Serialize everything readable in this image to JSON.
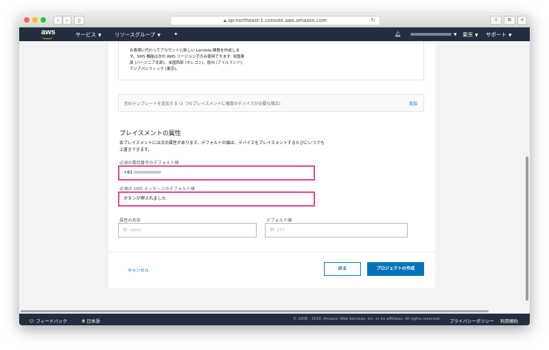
{
  "browser": {
    "url": "ap-northeast-1.console.aws.amazon.com",
    "back_icon": "chevron-left-icon",
    "forward_icon": "chevron-right-icon"
  },
  "nav": {
    "logo": "aws",
    "services": "サービス",
    "resource_groups": "リソースグループ",
    "region": "東京",
    "support": "サポート",
    "bell_icon": "bell-icon",
    "pin_icon": "pin-icon"
  },
  "info": {
    "text": "お客様に代わってアカウントに新しい Lambda 関数を作成します。SMS 機能は次の AWS リージョンでのみ使用できます: 米国東部 (バージニア北部)、米国西部 (オレゴン)、欧州 (アイルランド)、アジアパシフィック (東京)。"
  },
  "add_template": {
    "text": "別のテンプレートを追加する (1 つのプレイスメントに複数のデバイスが必要な場合)",
    "link": "追加"
  },
  "placement": {
    "heading": "プレイスメントの属性",
    "description": "各プレイスメントには次の属性があります。デフォルトの値は、デバイスをプレイスメントするたびにいつでも上書きできます。",
    "phone_label": "必須の電話番号のデフォルト値",
    "phone_value": "+81",
    "sms_label": "必須の SMS メッセージのデフォルト値",
    "sms_value": "ボタンが押されました",
    "attr_name_label": "属性の名前",
    "attr_name_placeholder": "例: room",
    "default_label": "デフォルト値",
    "default_placeholder": "例: 237"
  },
  "actions": {
    "cancel": "キャンセル",
    "back": "戻る",
    "create": "プロジェクトの作成"
  },
  "footer": {
    "feedback": "フィードバック",
    "language": "日本語",
    "copyright": "© 2008 - 2018, Amazon Web Services, Inc. or its affiliates. All rights reserved.",
    "privacy": "プライバシーポリシー",
    "terms": "利用規約"
  },
  "colors": {
    "accent": "#0073bb",
    "nav": "#232f3e",
    "highlight": "#e83e8c",
    "aws_orange": "#ff9900"
  }
}
